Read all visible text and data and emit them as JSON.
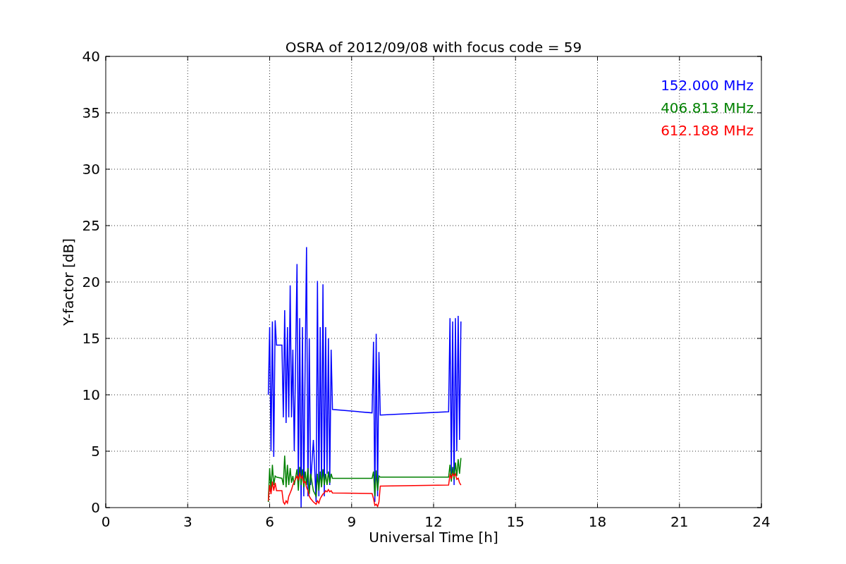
{
  "figure": {
    "chart_data": {
      "type": "line",
      "title": "OSRA of 2012/09/08 with focus code = 59",
      "xlabel": "Universal Time [h]",
      "ylabel": "Y-factor [dB]",
      "xlim": [
        0,
        24
      ],
      "ylim": [
        0,
        40
      ],
      "xticks": [
        0,
        3,
        6,
        9,
        12,
        15,
        18,
        21,
        24
      ],
      "yticks": [
        0,
        5,
        10,
        15,
        20,
        25,
        30,
        35,
        40
      ],
      "grid": true,
      "x": [
        5.95,
        6.0,
        6.05,
        6.1,
        6.15,
        6.2,
        6.25,
        6.45,
        6.5,
        6.55,
        6.6,
        6.65,
        6.7,
        6.75,
        6.8,
        6.85,
        6.9,
        7.0,
        7.05,
        7.1,
        7.15,
        7.2,
        7.25,
        7.3,
        7.35,
        7.4,
        7.45,
        7.5,
        7.6,
        7.7,
        7.75,
        7.8,
        7.85,
        7.9,
        7.95,
        8.0,
        8.05,
        8.1,
        8.15,
        8.2,
        8.25,
        8.3,
        9.75,
        9.8,
        9.85,
        9.9,
        9.95,
        10.0,
        10.05,
        12.55,
        12.6,
        12.65,
        12.7,
        12.75,
        12.8,
        12.85,
        12.9,
        12.95,
        13.0
      ],
      "series": [
        {
          "name": "152.000 MHz",
          "color": "#0000ff",
          "values": [
            10,
            16,
            5,
            16.5,
            4.5,
            16.6,
            14.4,
            14.4,
            8,
            17.5,
            7.5,
            16,
            8,
            19.7,
            8,
            14,
            5,
            21.6,
            2,
            16.8,
            0,
            16,
            1,
            13,
            23.1,
            1,
            15,
            2,
            6,
            0.5,
            20.1,
            1,
            16,
            2,
            19.8,
            1,
            16,
            3,
            15,
            2,
            14,
            8.7,
            8.4,
            14.7,
            0.5,
            15.4,
            1,
            13.8,
            8.2,
            8.5,
            16.8,
            3,
            16.5,
            2,
            16.8,
            5,
            17,
            6,
            16.5
          ]
        },
        {
          "name": "406.813 MHz",
          "color": "#008000",
          "values": [
            0.5,
            3.5,
            1.5,
            3.8,
            2,
            2.8,
            2.7,
            2.6,
            2,
            4.6,
            1.8,
            3.8,
            2,
            3.5,
            2.2,
            2.8,
            2,
            3.4,
            1.5,
            3.6,
            2,
            3.4,
            1.8,
            3.2,
            2,
            3.5,
            1.2,
            3,
            1.5,
            1,
            3,
            1.5,
            3.2,
            1.8,
            3.4,
            2,
            3,
            2,
            3.2,
            2.2,
            3,
            2.6,
            2.6,
            3.2,
            1,
            3.3,
            1.5,
            2.8,
            2.7,
            2.7,
            3.8,
            2.3,
            3.6,
            2.5,
            4,
            2.8,
            4.3,
            3,
            4.4
          ]
        },
        {
          "name": "612.188 MHz",
          "color": "#ff0000",
          "values": [
            0.6,
            2,
            1.2,
            2.3,
            1.5,
            2.2,
            1.5,
            1.5,
            0.5,
            0.3,
            0.6,
            0.4,
            1,
            1.3,
            1.6,
            2,
            2.3,
            2.8,
            2.5,
            3,
            2.6,
            2.8,
            2.2,
            2.3,
            1.8,
            1.5,
            1,
            0.8,
            0.5,
            0.3,
            0.6,
            0.4,
            0.8,
            1,
            1.2,
            1.3,
            1.5,
            1.4,
            1.6,
            1.4,
            1.5,
            1.3,
            1.25,
            0.8,
            0.2,
            0.3,
            0.1,
            0.5,
            1.9,
            2,
            2.9,
            2.6,
            3,
            2.8,
            3,
            2.5,
            2.6,
            2.2,
            2
          ]
        }
      ]
    }
  }
}
